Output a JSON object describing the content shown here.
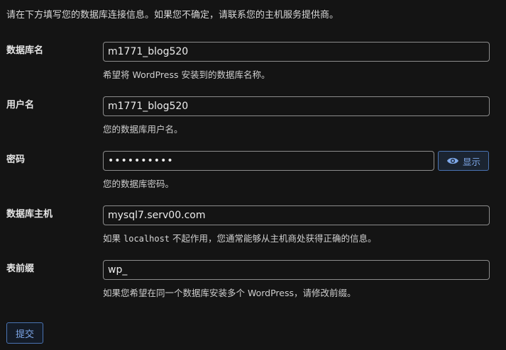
{
  "intro": "请在下方填写您的数据库连接信息。如果您不确定，请联系您的主机服务提供商。",
  "fields": {
    "dbname": {
      "label": "数据库名",
      "value": "m1771_blog520",
      "help": "希望将 WordPress 安装到的数据库名称。"
    },
    "username": {
      "label": "用户名",
      "value": "m1771_blog520",
      "help": "您的数据库用户名。"
    },
    "password": {
      "label": "密码",
      "value": "••••••••••",
      "toggle_label": "显示",
      "help": "您的数据库密码。"
    },
    "dbhost": {
      "label": "数据库主机",
      "value": "mysql7.serv00.com",
      "help_before": "如果",
      "help_code": "localhost",
      "help_after": "不起作用，您通常能够从主机商处获得正确的信息。"
    },
    "prefix": {
      "label": "表前缀",
      "value": "wp_",
      "help": "如果您希望在同一个数据库安装多个 WordPress，请修改前缀。"
    }
  },
  "submit_label": "提交",
  "colors": {
    "background": "#141414",
    "accent": "#7ea8ea",
    "border": "#8c8c8c"
  }
}
